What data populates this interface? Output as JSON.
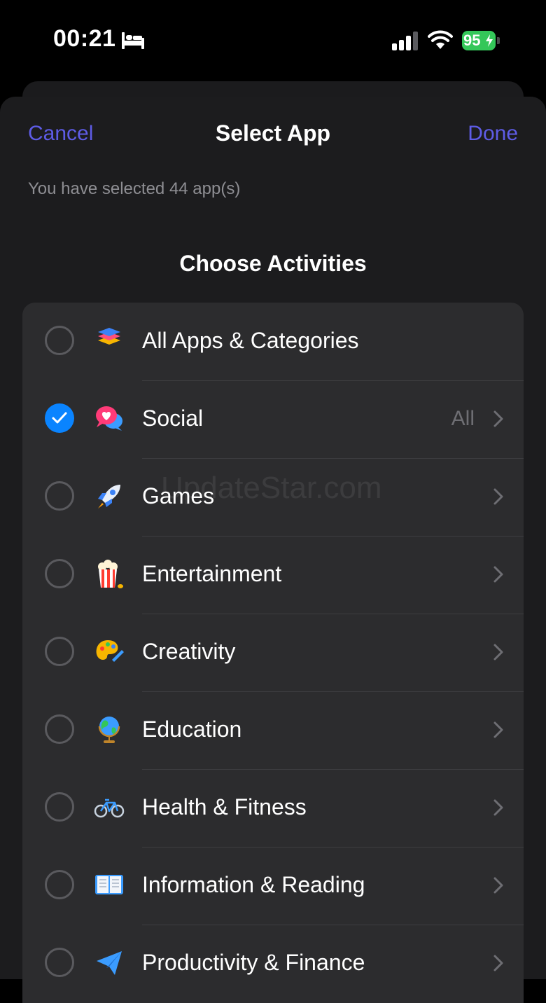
{
  "status_bar": {
    "time": "00:21",
    "battery": "95"
  },
  "header": {
    "cancel_label": "Cancel",
    "title": "Select App",
    "done_label": "Done"
  },
  "selected_text": "You have selected 44 app(s)",
  "section_title": "Choose Activities",
  "categories": [
    {
      "label": "All Apps & Categories",
      "icon": "stack-icon",
      "checked": false,
      "detail": ""
    },
    {
      "label": "Social",
      "icon": "speech-bubbles-heart-icon",
      "checked": true,
      "detail": "All"
    },
    {
      "label": "Games",
      "icon": "rocket-icon",
      "checked": false,
      "detail": ""
    },
    {
      "label": "Entertainment",
      "icon": "popcorn-icon",
      "checked": false,
      "detail": ""
    },
    {
      "label": "Creativity",
      "icon": "palette-icon",
      "checked": false,
      "detail": ""
    },
    {
      "label": "Education",
      "icon": "globe-icon",
      "checked": false,
      "detail": ""
    },
    {
      "label": "Health & Fitness",
      "icon": "bicycle-icon",
      "checked": false,
      "detail": ""
    },
    {
      "label": "Information & Reading",
      "icon": "book-icon",
      "checked": false,
      "detail": ""
    },
    {
      "label": "Productivity & Finance",
      "icon": "paper-plane-icon",
      "checked": false,
      "detail": ""
    }
  ],
  "watermark": "UpdateStar.com",
  "colors": {
    "accent": "#5e5ce6",
    "check": "#0a84ff",
    "battery": "#34c759",
    "sheet": "#1c1c1e",
    "list": "#2c2c2e"
  }
}
